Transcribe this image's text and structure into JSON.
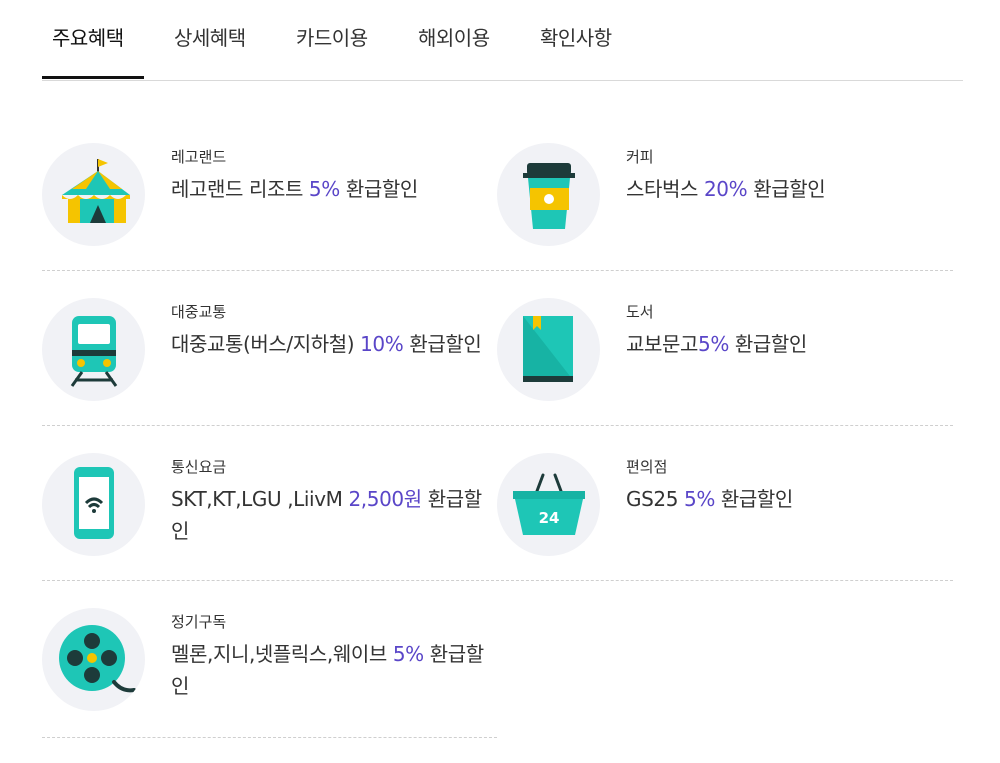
{
  "tabs": [
    {
      "label": "주요혜택",
      "active": true
    },
    {
      "label": "상세혜택",
      "active": false
    },
    {
      "label": "카드이용",
      "active": false
    },
    {
      "label": "해외이용",
      "active": false
    },
    {
      "label": "확인사항",
      "active": false
    }
  ],
  "colors": {
    "highlight": "#5a46c8",
    "icon_teal": "#1ec6b6",
    "icon_bg": "#f1f2f6",
    "tab_underline": "#111111"
  },
  "benefits": [
    {
      "category": "레고랜드",
      "pre": "레고랜드 리조트 ",
      "highlight": "5%",
      "post": " 환급할인",
      "icon": "tent-icon"
    },
    {
      "category": "커피",
      "pre": "스타벅스 ",
      "highlight": "20%",
      "post": " 환급할인",
      "icon": "coffee-cup-icon"
    },
    {
      "category": "대중교통",
      "pre": "대중교통(버스/지하철) ",
      "highlight": "10%",
      "post": " 환급할인",
      "icon": "train-icon"
    },
    {
      "category": "도서",
      "pre": "교보문고",
      "highlight": "5%",
      "post": " 환급할인",
      "icon": "book-icon"
    },
    {
      "category": "통신요금",
      "pre": "SKT,KT,LGU ,LiivM ",
      "highlight": "2,500원",
      "post": " 환급할인",
      "icon": "smartphone-wifi-icon"
    },
    {
      "category": "편의점",
      "pre": "GS25 ",
      "highlight": "5%",
      "post": " 환급할인",
      "icon": "basket-24-icon",
      "icon_text": "24"
    },
    {
      "category": "정기구독",
      "pre": "멜론,지니,넷플릭스,웨이브 ",
      "highlight": "5%",
      "post": " 환급할인",
      "icon": "film-reel-icon"
    }
  ]
}
